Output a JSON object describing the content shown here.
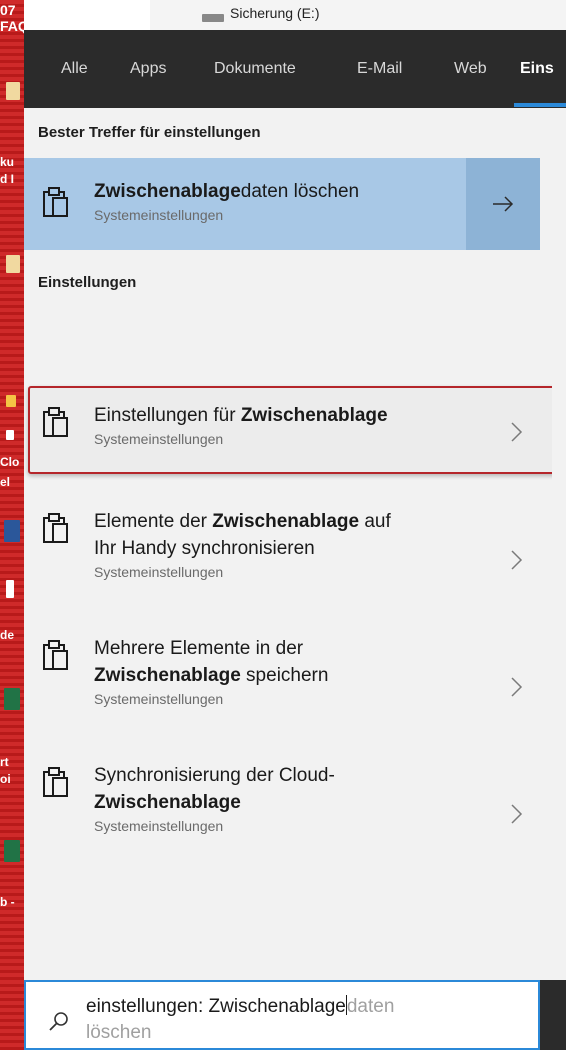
{
  "desktop": {
    "top_label": "07 FAQ",
    "snippets": [
      "ku",
      "d I",
      "Clo",
      "el",
      "de",
      "rt",
      "oi",
      "b -"
    ]
  },
  "behind_window": {
    "drive_label": "Sicherung (E:)"
  },
  "tabs": [
    {
      "label": "Alle"
    },
    {
      "label": "Apps"
    },
    {
      "label": "Dokumente"
    },
    {
      "label": "E-Mail"
    },
    {
      "label": "Web"
    },
    {
      "label": "Eins"
    }
  ],
  "best_match": {
    "header": "Bester Treffer für einstellungen",
    "title_bold": "Zwischenablage",
    "title_rest": "daten löschen",
    "subtitle": "Systemeinstellungen",
    "icon": "clipboard-icon",
    "arrow_icon": "arrow-right-icon"
  },
  "settings_section": {
    "header": "Einstellungen",
    "items": [
      {
        "line1_pre": "Einstellungen für ",
        "line1_bold": "Zwischenablage",
        "line1_post": "",
        "line2_pre": "",
        "line2_bold": "",
        "line2_post": "",
        "subtitle": "Systemeinstellungen",
        "highlighted": true
      },
      {
        "line1_pre": "Elemente der ",
        "line1_bold": "Zwischenablage",
        "line1_post": " auf",
        "line2_pre": "Ihr Handy synchronisieren",
        "line2_bold": "",
        "line2_post": "",
        "subtitle": "Systemeinstellungen",
        "highlighted": false
      },
      {
        "line1_pre": "Mehrere Elemente in der",
        "line1_bold": "",
        "line1_post": "",
        "line2_pre": "",
        "line2_bold": "Zwischenablage",
        "line2_post": " speichern",
        "subtitle": "Systemeinstellungen",
        "highlighted": false
      },
      {
        "line1_pre": "Synchronisierung der Cloud-",
        "line1_bold": "",
        "line1_post": "",
        "line2_pre": "",
        "line2_bold": "Zwischenablage",
        "line2_post": "",
        "subtitle": "Systemeinstellungen",
        "highlighted": false
      }
    ]
  },
  "search": {
    "typed": "einstellungen: Zwischenablage",
    "suggest_inline": "daten",
    "suggest_line2": "löschen",
    "icon": "search-icon"
  },
  "colors": {
    "accent": "#2b89d8",
    "best_match_bg": "#a8c8e6",
    "highlight_border": "#b5262b",
    "tab_bar": "#2b2b2b"
  }
}
